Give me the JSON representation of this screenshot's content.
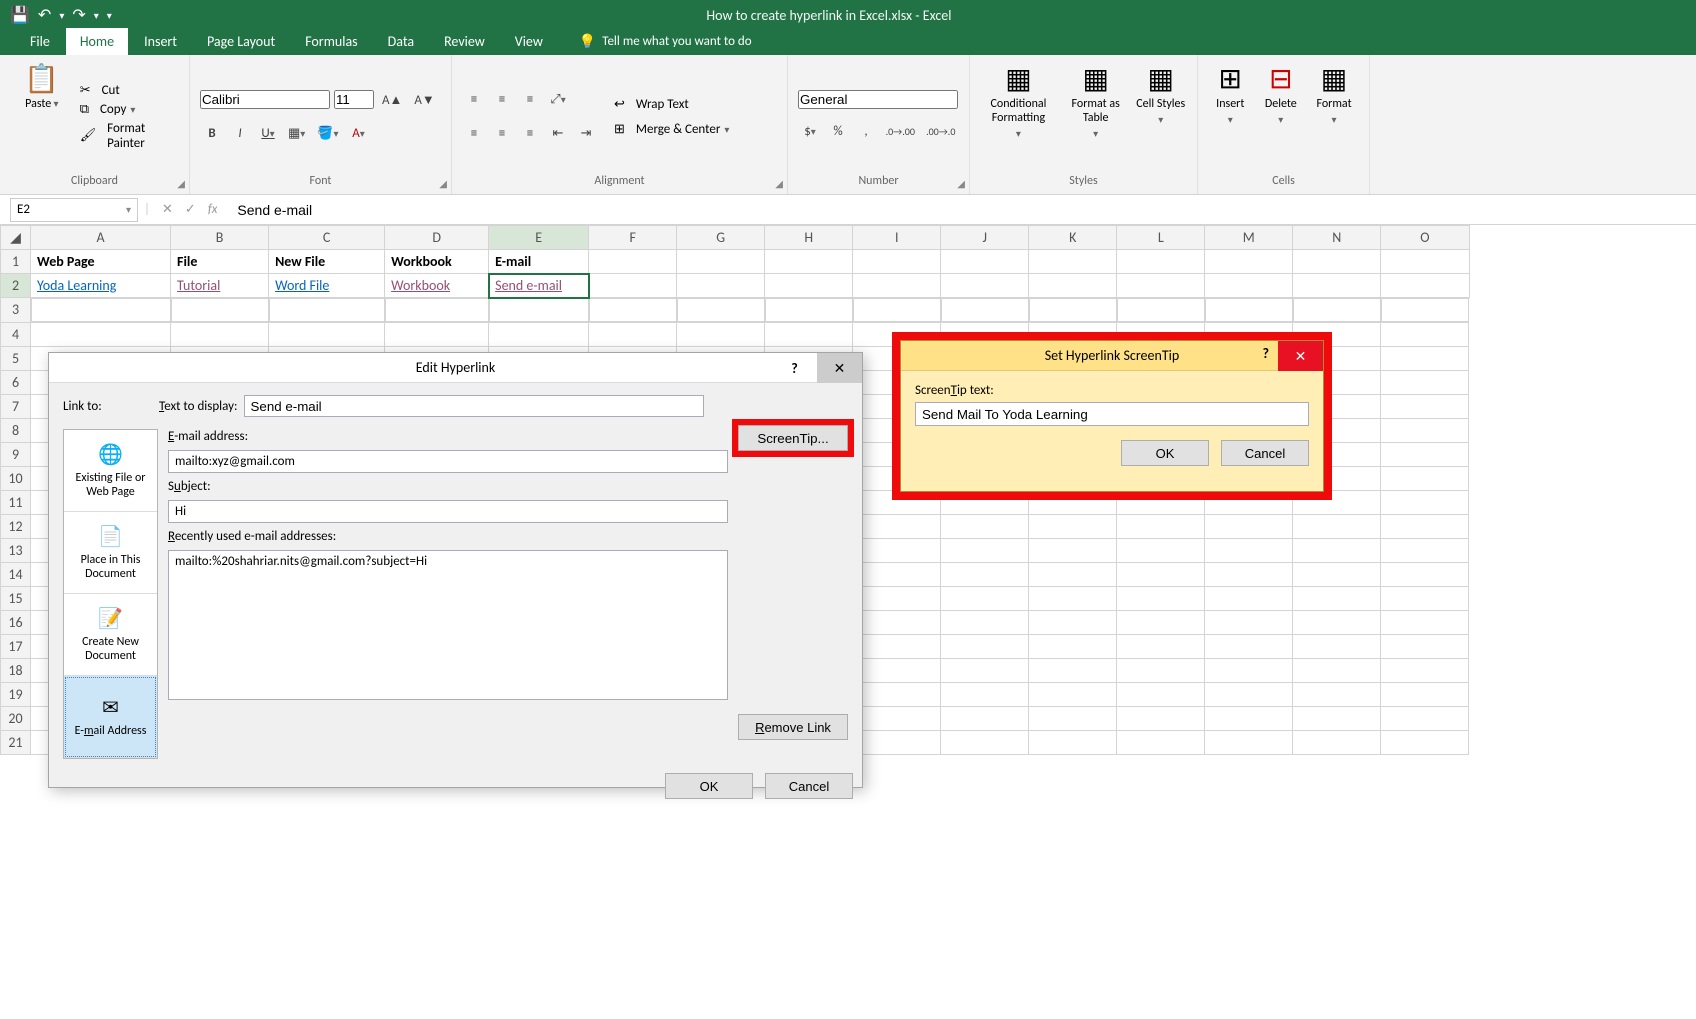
{
  "window": {
    "title": "How to create hyperlink in Excel.xlsx - Excel"
  },
  "qat": {
    "save": "💾",
    "undo": "↶",
    "redo": "↷",
    "more": "▾"
  },
  "tabs": [
    "File",
    "Home",
    "Insert",
    "Page Layout",
    "Formulas",
    "Data",
    "Review",
    "View"
  ],
  "tellme": "Tell me what you want to do",
  "ribbon": {
    "clipboard": {
      "label": "Clipboard",
      "paste": "Paste",
      "cut": "Cut",
      "copy": "Copy",
      "format_painter": "Format Painter"
    },
    "font": {
      "label": "Font",
      "family": "Calibri",
      "size": "11",
      "bold": "B",
      "italic": "I",
      "underline": "U"
    },
    "alignment": {
      "label": "Alignment",
      "wrap": "Wrap Text",
      "merge": "Merge & Center"
    },
    "number": {
      "label": "Number",
      "format": "General",
      "currency": "$",
      "percent": "%",
      "comma": ",",
      "inc": ".00→.0",
      "dec": ".0→.00"
    },
    "styles": {
      "label": "Styles",
      "cond": "Conditional Formatting",
      "table": "Format as Table",
      "cell": "Cell Styles"
    },
    "cells": {
      "label": "Cells",
      "insert": "Insert",
      "delete": "Delete",
      "format": "Format"
    }
  },
  "formula_bar": {
    "name_box": "E2",
    "fx_value": "Send e-mail"
  },
  "columns": [
    "A",
    "B",
    "C",
    "D",
    "E",
    "F",
    "G",
    "H",
    "I",
    "J",
    "K",
    "L",
    "M",
    "N",
    "O"
  ],
  "rows": {
    "1": {
      "A": "Web Page",
      "B": "File",
      "C": "New File",
      "D": "Workbook",
      "E": "E-mail"
    },
    "2": {
      "A": "Yoda Learning",
      "B": "Tutorial",
      "C": "Word File",
      "D": "Workbook",
      "E": "Send e-mail"
    }
  },
  "edit_hyperlink": {
    "title": "Edit Hyperlink",
    "link_to": "Link to:",
    "text_to_display_label": "Text to display:",
    "text_to_display": "Send e-mail",
    "screentip_btn": "ScreenTip...",
    "items": {
      "existing": "Existing File or Web Page",
      "place": "Place in This Document",
      "create": "Create New Document",
      "email": "E-mail Address"
    },
    "email_label": "E-mail address:",
    "email_value": "mailto:xyz@gmail.com",
    "subject_label": "Subject:",
    "subject_value": "Hi",
    "recent_label": "Recently used e-mail addresses:",
    "recent_value": "mailto:%20shahriar.nits@gmail.com?subject=Hi",
    "remove": "Remove Link",
    "ok": "OK",
    "cancel": "Cancel"
  },
  "screentip": {
    "title": "Set Hyperlink ScreenTip",
    "label": "ScreenTip text:",
    "value": "Send Mail To Yoda Learning",
    "ok": "OK",
    "cancel": "Cancel"
  }
}
